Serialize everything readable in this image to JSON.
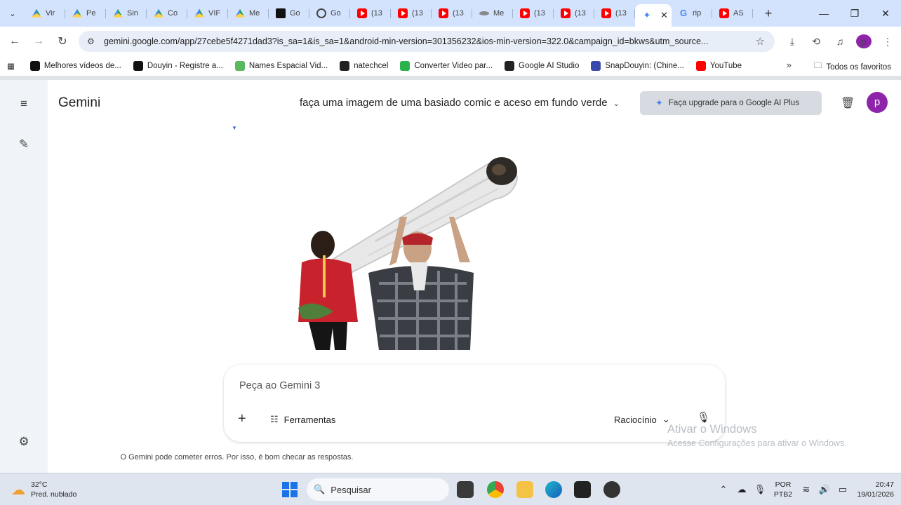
{
  "browser": {
    "tabs": [
      {
        "label": "Vir",
        "icon": "drive-icon"
      },
      {
        "label": "Pe",
        "icon": "drive-icon"
      },
      {
        "label": "Sin",
        "icon": "drive-icon"
      },
      {
        "label": "Co",
        "icon": "drive-icon"
      },
      {
        "label": "VIF",
        "icon": "drive-icon"
      },
      {
        "label": "Me",
        "icon": "drive-icon"
      },
      {
        "label": "Go",
        "icon": "capcut-icon"
      },
      {
        "label": "Go",
        "icon": "chatgpt-icon"
      },
      {
        "label": "(13",
        "icon": "youtube-icon"
      },
      {
        "label": "(13",
        "icon": "youtube-icon"
      },
      {
        "label": "(13",
        "icon": "youtube-icon"
      },
      {
        "label": "Me",
        "icon": "meet-icon"
      },
      {
        "label": "(13",
        "icon": "youtube-icon"
      },
      {
        "label": "(13",
        "icon": "youtube-icon"
      },
      {
        "label": "(13",
        "icon": "youtube-icon"
      },
      {
        "label": "",
        "icon": "gemini-icon",
        "active": true
      },
      {
        "label": "rip",
        "icon": "google-icon"
      },
      {
        "label": "AS",
        "icon": "youtube-icon"
      }
    ],
    "url": "gemini.google.com/app/27cebe5f4271dad3?is_sa=1&is_sa=1&android-min-version=301356232&ios-min-version=322.0&campaign_id=bkws&utm_source...",
    "profile_initial": "p",
    "bookmarks": [
      {
        "label": "Melhores vídeos de...",
        "color": "#111111"
      },
      {
        "label": "Douyin - Registre a...",
        "color": "#111111"
      },
      {
        "label": "Names Espacial Vid...",
        "color": "#5cb85c"
      },
      {
        "label": "natechcel",
        "color": "#222222"
      },
      {
        "label": "Converter Video par...",
        "color": "#2bb24c"
      },
      {
        "label": "Google AI Studio",
        "color": "#222222"
      },
      {
        "label": "SnapDouyin: (Chine...",
        "color": "#3949ab"
      },
      {
        "label": "YouTube",
        "color": "#ff0000"
      }
    ],
    "all_bookmarks": "Todos os favoritos"
  },
  "gemini": {
    "brand": "Gemini",
    "chat_title": "faça uma imagem de uma basiado comic e aceso em fundo verde",
    "upgrade_label": "Faça upgrade para o Google AI Plus",
    "avatar_initial": "p",
    "composer": {
      "placeholder": "Peça ao Gemini 3",
      "tools_label": "Ferramentas",
      "model_label": "Raciocínio"
    },
    "disclaimer": "O Gemini pode cometer erros. Por isso, é bom checar as respostas."
  },
  "watermark": {
    "title": "Ativar o Windows",
    "subtitle": "Acesse Configurações para ativar o Windows."
  },
  "taskbar": {
    "temperature": "32°C",
    "weather": "Pred. nublado",
    "search_label": "Pesquisar",
    "lang_top": "POR",
    "lang_bottom": "PTB2",
    "time": "20:47",
    "date": "19/01/2026"
  },
  "colors": {
    "tabstrip": "#d3e3fd",
    "accent_purple": "#8e24aa",
    "gemini_blue": "#4285f4"
  }
}
